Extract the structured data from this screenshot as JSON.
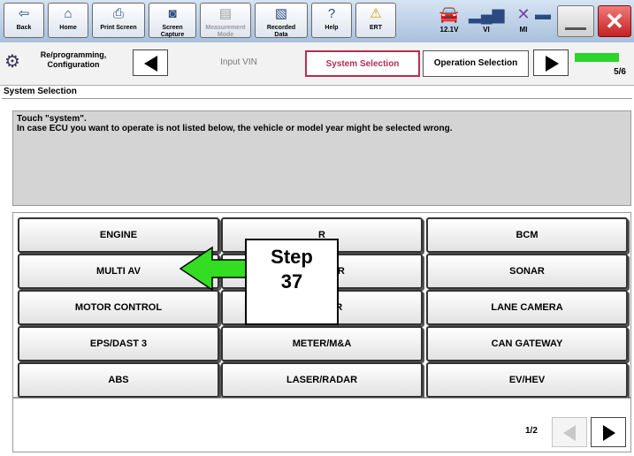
{
  "toolbar": {
    "back": "Back",
    "home": "Home",
    "print_screen": "Print Screen",
    "screen_capture": "Screen\nCapture",
    "measurement_mode": "Measurement\nMode",
    "recorded_data": "Recorded\nData",
    "help": "Help",
    "ert": "ERT",
    "voltage": "12.1V",
    "vi": "VI",
    "mi": "MI"
  },
  "nav": {
    "reprogramming": "Re/programming,\nConfiguration",
    "input_vin": "Input VIN",
    "system_selection": "System Selection",
    "operation_selection": "Operation Selection",
    "progress": "5/6",
    "progress_fraction": 0.83
  },
  "section_title": "System Selection",
  "message": {
    "line1": "Touch \"system\".",
    "line2": "In case ECU you want to operate is not listed below, the vehicle or model year might be selected wrong."
  },
  "systems": [
    [
      "ENGINE",
      "R",
      "BCM"
    ],
    [
      "MULTI AV",
      "MONITOR",
      "SONAR"
    ],
    [
      "MOTOR CONTROL",
      "VELIZER",
      "LANE CAMERA"
    ],
    [
      "EPS/DAST 3",
      "METER/M&A",
      "CAN GATEWAY"
    ],
    [
      "ABS",
      "LASER/RADAR",
      "EV/HEV"
    ]
  ],
  "callout": {
    "line1": "Step",
    "line2": "37"
  },
  "pagination": "1/2",
  "colors": {
    "active_tab": "#b33050",
    "callout_arrow": "#33dd22",
    "progress": "#2bd52b"
  }
}
